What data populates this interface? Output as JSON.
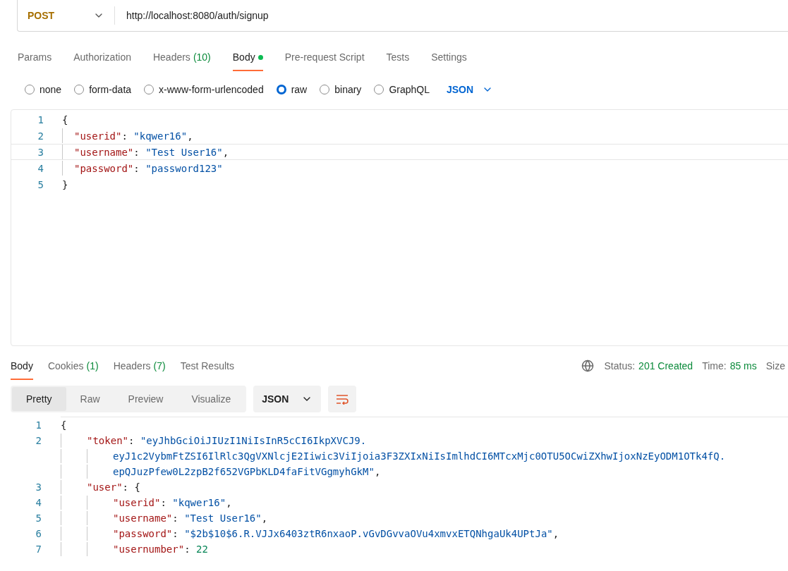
{
  "request": {
    "method": "POST",
    "url": "http://localhost:8080/auth/signup"
  },
  "request_tabs": [
    {
      "label": "Params",
      "selected": false
    },
    {
      "label": "Authorization",
      "selected": false
    },
    {
      "label": "Headers",
      "count": "(10)",
      "selected": false
    },
    {
      "label": "Body",
      "selected": true,
      "dot": true
    },
    {
      "label": "Pre-request Script",
      "selected": false
    },
    {
      "label": "Tests",
      "selected": false
    },
    {
      "label": "Settings",
      "selected": false
    }
  ],
  "body_types": [
    {
      "label": "none",
      "selected": false
    },
    {
      "label": "form-data",
      "selected": false
    },
    {
      "label": "x-www-form-urlencoded",
      "selected": false
    },
    {
      "label": "raw",
      "selected": true
    },
    {
      "label": "binary",
      "selected": false
    },
    {
      "label": "GraphQL",
      "selected": false
    }
  ],
  "body_format": "JSON",
  "request_body": [
    {
      "number": "1",
      "active": false,
      "rows": [
        [
          {
            "kind": "punct",
            "text": "{"
          }
        ]
      ],
      "children": [
        {
          "number": "2",
          "active": false,
          "rows": [
            [
              {
                "kind": "key",
                "text": "\"userid\""
              },
              {
                "kind": "punct",
                "text": ": "
              },
              {
                "kind": "string",
                "text": "\"kqwer16\""
              },
              {
                "kind": "punct",
                "text": ","
              }
            ]
          ]
        },
        {
          "number": "3",
          "active": true,
          "rows": [
            [
              {
                "kind": "key",
                "text": "\"username\""
              },
              {
                "kind": "punct",
                "text": ": "
              },
              {
                "kind": "string",
                "text": "\"Test User16\""
              },
              {
                "kind": "punct",
                "text": ","
              }
            ]
          ]
        },
        {
          "number": "4",
          "active": false,
          "rows": [
            [
              {
                "kind": "key",
                "text": "\"password\""
              },
              {
                "kind": "punct",
                "text": ": "
              },
              {
                "kind": "string",
                "text": "\"password123\""
              }
            ]
          ]
        }
      ]
    },
    {
      "number": "5",
      "active": false,
      "rows": [
        [
          {
            "kind": "punct",
            "text": "}"
          }
        ]
      ]
    }
  ],
  "response_tabs": [
    {
      "label": "Body",
      "selected": true
    },
    {
      "label": "Cookies",
      "count": "(1)",
      "selected": false
    },
    {
      "label": "Headers",
      "count": "(7)",
      "selected": false
    },
    {
      "label": "Test Results",
      "selected": false
    }
  ],
  "response_status": {
    "status_label": "Status:",
    "status": "201 Created",
    "time_label": "Time:",
    "time": "85 ms",
    "size_label": "Size"
  },
  "view_modes": [
    {
      "label": "Pretty",
      "selected": true
    },
    {
      "label": "Raw",
      "selected": false
    },
    {
      "label": "Preview",
      "selected": false
    },
    {
      "label": "Visualize",
      "selected": false
    }
  ],
  "response_format": "JSON",
  "response_body": [
    {
      "number": "1",
      "rows": [
        [
          {
            "kind": "punct",
            "text": "{"
          }
        ]
      ],
      "children": [
        {
          "number": "2",
          "rows": [
            [
              {
                "kind": "key",
                "text": "\"token\""
              },
              {
                "kind": "punct",
                "text": ": "
              },
              {
                "kind": "string",
                "text": "\"eyJhbGciOiJIUzI1NiIsInR5cCI6IkpXVCJ9.",
                "wrapped": [
                  "eyJ1c2VybmFtZSI6IlRlc3QgVXNlcjE2Iiwic3ViIjoia3F3ZXIxNiIsImlhdCI6MTcxMjc0OTU5OCwiZXhwIjoxNzEyODM1OTk4fQ.",
                  "epQJuzPfew0L2zpB2f652VGPbKLD4faFitVGgmyhGkM\""
                ]
              },
              {
                "kind": "punct",
                "text": ","
              }
            ]
          ]
        },
        {
          "number": "3",
          "rows": [
            [
              {
                "kind": "key",
                "text": "\"user\""
              },
              {
                "kind": "punct",
                "text": ": {"
              }
            ]
          ],
          "children": [
            {
              "number": "4",
              "rows": [
                [
                  {
                    "kind": "key",
                    "text": "\"userid\""
                  },
                  {
                    "kind": "punct",
                    "text": ": "
                  },
                  {
                    "kind": "string",
                    "text": "\"kqwer16\""
                  },
                  {
                    "kind": "punct",
                    "text": ","
                  }
                ]
              ]
            },
            {
              "number": "5",
              "rows": [
                [
                  {
                    "kind": "key",
                    "text": "\"username\""
                  },
                  {
                    "kind": "punct",
                    "text": ": "
                  },
                  {
                    "kind": "string",
                    "text": "\"Test User16\""
                  },
                  {
                    "kind": "punct",
                    "text": ","
                  }
                ]
              ]
            },
            {
              "number": "6",
              "rows": [
                [
                  {
                    "kind": "key",
                    "text": "\"password\""
                  },
                  {
                    "kind": "punct",
                    "text": ": "
                  },
                  {
                    "kind": "string",
                    "text": "\"$2b$10$6.R.VJJx6403ztR6nxaoP.vGvDGvvaOVu4xmvxETQNhgaUk4UPtJa\""
                  },
                  {
                    "kind": "punct",
                    "text": ","
                  }
                ]
              ]
            },
            {
              "number": "7",
              "rows": [
                [
                  {
                    "kind": "key",
                    "text": "\"usernumber\""
                  },
                  {
                    "kind": "punct",
                    "text": ": "
                  },
                  {
                    "kind": "number",
                    "text": "22"
                  }
                ]
              ]
            }
          ]
        }
      ]
    }
  ]
}
